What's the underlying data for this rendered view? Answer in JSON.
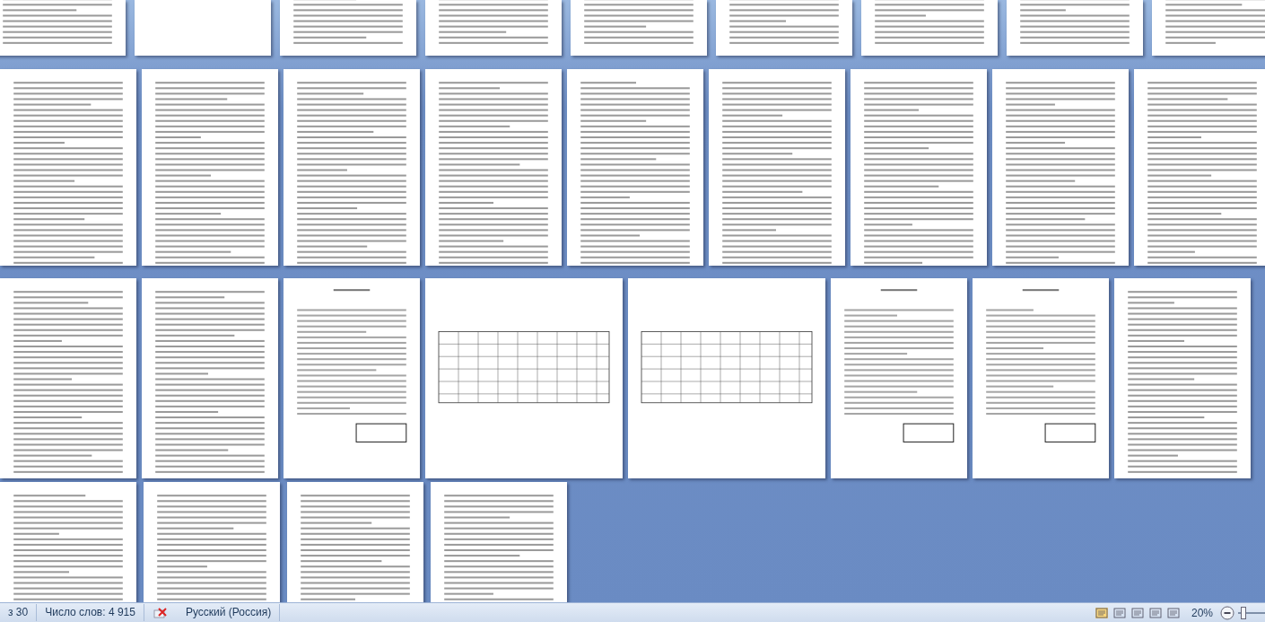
{
  "document": {
    "rows": [
      {
        "pages": [
          {
            "kind": "text"
          },
          {
            "kind": "blank"
          },
          {
            "kind": "text"
          },
          {
            "kind": "text"
          },
          {
            "kind": "text"
          },
          {
            "kind": "text"
          },
          {
            "kind": "text"
          },
          {
            "kind": "text"
          },
          {
            "kind": "text"
          }
        ]
      },
      {
        "pages": [
          {
            "kind": "text"
          },
          {
            "kind": "text"
          },
          {
            "kind": "text"
          },
          {
            "kind": "text"
          },
          {
            "kind": "text"
          },
          {
            "kind": "text"
          },
          {
            "kind": "text"
          },
          {
            "kind": "text"
          },
          {
            "kind": "text"
          }
        ]
      },
      {
        "pages": [
          {
            "kind": "text"
          },
          {
            "kind": "text"
          },
          {
            "kind": "form"
          },
          {
            "kind": "table"
          },
          {
            "kind": "table"
          },
          {
            "kind": "form"
          },
          {
            "kind": "form"
          },
          {
            "kind": "text"
          }
        ]
      },
      {
        "pages": [
          {
            "kind": "text"
          },
          {
            "kind": "text"
          },
          {
            "kind": "text"
          },
          {
            "kind": "text"
          }
        ]
      }
    ]
  },
  "status_bar": {
    "page": "з 30",
    "words": "Число слов: 4 915",
    "language": "Русский (Россия)",
    "zoom": "20%",
    "zoom_slider": {
      "level": 0.1
    }
  }
}
